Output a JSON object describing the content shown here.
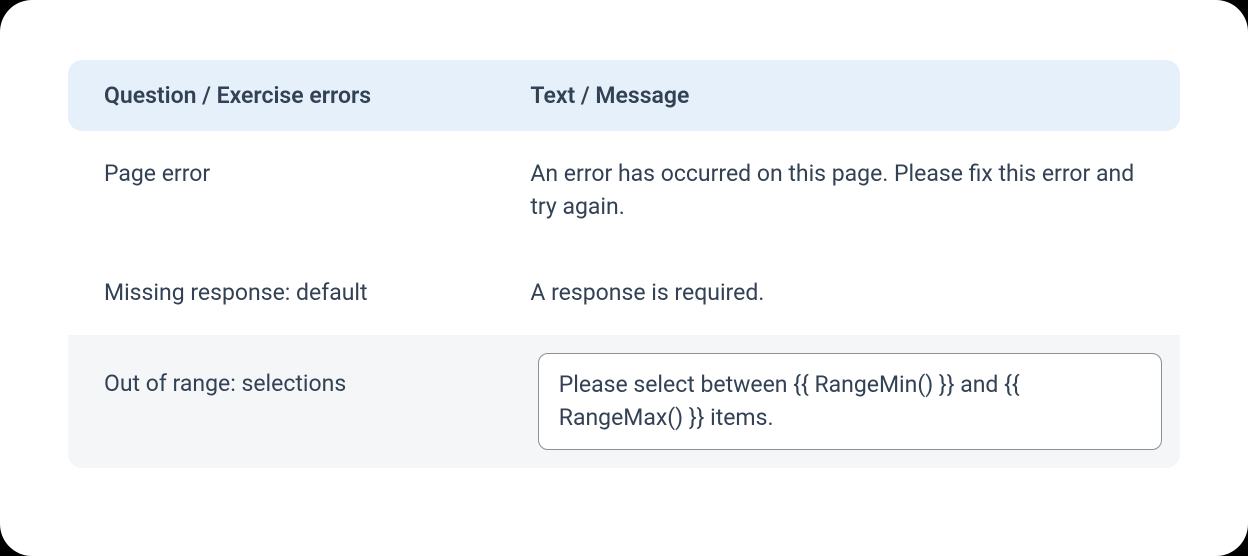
{
  "headers": {
    "col1": "Question / Exercise errors",
    "col2": "Text / Message"
  },
  "rows": [
    {
      "label": "Page error",
      "message": "An error has occurred on this page. Please fix this error and try again.",
      "editing": false
    },
    {
      "label": "Missing response: default",
      "message": "A response is required.",
      "editing": false
    },
    {
      "label": "Out of range: selections",
      "message": "Please select between {{ RangeMin() }} and {{ RangeMax() }} items.",
      "editing": true
    }
  ]
}
